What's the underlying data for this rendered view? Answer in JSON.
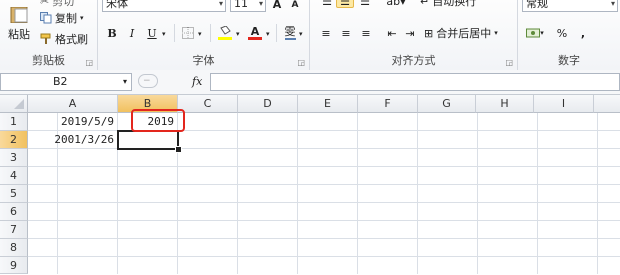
{
  "ribbon": {
    "clipboard": {
      "paste_label": "粘贴",
      "cut_label": "剪切",
      "copy_label": "复制",
      "format_painter_label": "格式刷",
      "group_label": "剪贴板"
    },
    "font": {
      "font_name": "宋体",
      "font_size": "11",
      "bold": "B",
      "italic": "I",
      "underline": "U",
      "grow_font": "A",
      "shrink_font": "A",
      "phonetic": "雯",
      "fill_color": "#ffff00",
      "font_color": "#e3261d",
      "group_label": "字体"
    },
    "alignment": {
      "wrap_text_label": "自动换行",
      "merge_center_label": "合并后居中",
      "group_label": "对齐方式"
    },
    "number": {
      "format_value": "常规",
      "percent": "%",
      "comma": ",",
      "group_label": "数字"
    }
  },
  "formula_bar": {
    "name_box": "B2",
    "fx_label": "fx",
    "formula": ""
  },
  "sheet": {
    "columns": [
      "A",
      "B",
      "C",
      "D",
      "E",
      "F",
      "G",
      "H",
      "I"
    ],
    "rows": [
      "1",
      "2",
      "3",
      "4",
      "5",
      "6",
      "7",
      "8",
      "9"
    ],
    "cells": {
      "A1": "2019/5/9",
      "B1": "2019",
      "A2": "2001/3/26"
    },
    "active_cell": "B2",
    "highlight_color": "#e3261d"
  }
}
